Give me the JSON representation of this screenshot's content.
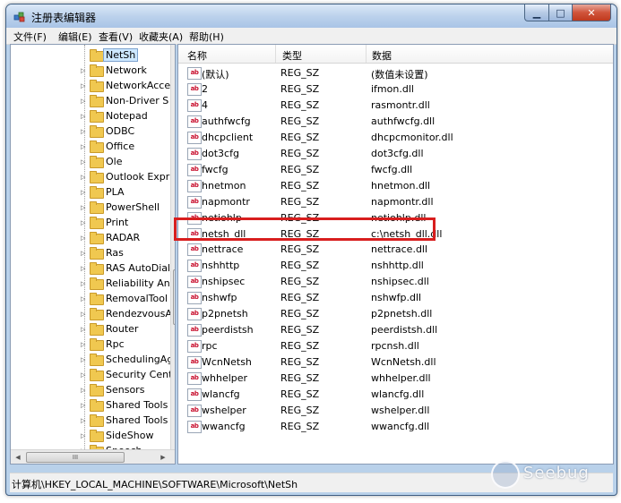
{
  "window": {
    "title": "注册表编辑器"
  },
  "menu": [
    "文件(F)",
    "编辑(E)",
    "查看(V)",
    "收藏夹(A)",
    "帮助(H)"
  ],
  "tree": {
    "items": [
      "NetSh",
      "Network",
      "NetworkAcce",
      "Non-Driver S",
      "Notepad",
      "ODBC",
      "Office",
      "Ole",
      "Outlook Expr",
      "PLA",
      "PowerShell",
      "Print",
      "RADAR",
      "Ras",
      "RAS AutoDial",
      "Reliability Ana",
      "RemovalTool",
      "RendezvousA",
      "Router",
      "Rpc",
      "SchedulingAg",
      "Security Cent",
      "Sensors",
      "Shared Tools",
      "Shared Tools",
      "SideShow",
      "Speech"
    ],
    "selected_index": 0,
    "scroll_h_label": "III"
  },
  "list": {
    "columns": [
      "名称",
      "类型",
      "数据"
    ],
    "rows": [
      {
        "name": "(默认)",
        "type": "REG_SZ",
        "data": "(数值未设置)"
      },
      {
        "name": "2",
        "type": "REG_SZ",
        "data": "ifmon.dll"
      },
      {
        "name": "4",
        "type": "REG_SZ",
        "data": "rasmontr.dll"
      },
      {
        "name": "authfwcfg",
        "type": "REG_SZ",
        "data": "authfwcfg.dll"
      },
      {
        "name": "dhcpclient",
        "type": "REG_SZ",
        "data": "dhcpcmonitor.dll"
      },
      {
        "name": "dot3cfg",
        "type": "REG_SZ",
        "data": "dot3cfg.dll"
      },
      {
        "name": "fwcfg",
        "type": "REG_SZ",
        "data": "fwcfg.dll"
      },
      {
        "name": "hnetmon",
        "type": "REG_SZ",
        "data": "hnetmon.dll"
      },
      {
        "name": "napmontr",
        "type": "REG_SZ",
        "data": "napmontr.dll"
      },
      {
        "name": "netiohlp",
        "type": "REG_SZ",
        "data": "netiohlp.dll"
      },
      {
        "name": "netsh_dll",
        "type": "REG_SZ",
        "data": "c:\\netsh_dll.dll"
      },
      {
        "name": "nettrace",
        "type": "REG_SZ",
        "data": "nettrace.dll"
      },
      {
        "name": "nshhttp",
        "type": "REG_SZ",
        "data": "nshhttp.dll"
      },
      {
        "name": "nshipsec",
        "type": "REG_SZ",
        "data": "nshipsec.dll"
      },
      {
        "name": "nshwfp",
        "type": "REG_SZ",
        "data": "nshwfp.dll"
      },
      {
        "name": "p2pnetsh",
        "type": "REG_SZ",
        "data": "p2pnetsh.dll"
      },
      {
        "name": "peerdistsh",
        "type": "REG_SZ",
        "data": "peerdistsh.dll"
      },
      {
        "name": "rpc",
        "type": "REG_SZ",
        "data": "rpcnsh.dll"
      },
      {
        "name": "WcnNetsh",
        "type": "REG_SZ",
        "data": "WcnNetsh.dll"
      },
      {
        "name": "whhelper",
        "type": "REG_SZ",
        "data": "whhelper.dll"
      },
      {
        "name": "wlancfg",
        "type": "REG_SZ",
        "data": "wlancfg.dll"
      },
      {
        "name": "wshelper",
        "type": "REG_SZ",
        "data": "wshelper.dll"
      },
      {
        "name": "wwancfg",
        "type": "REG_SZ",
        "data": "wwancfg.dll"
      }
    ],
    "icon_text": "ab",
    "highlighted_index": 10
  },
  "status": {
    "path": "计算机\\HKEY_LOCAL_MACHINE\\SOFTWARE\\Microsoft\\NetSh"
  },
  "watermark": {
    "text": "Seebug"
  },
  "colors": {
    "highlight": "#d81e1e",
    "selection": "#cde8ff",
    "folder": "#f0c850"
  }
}
